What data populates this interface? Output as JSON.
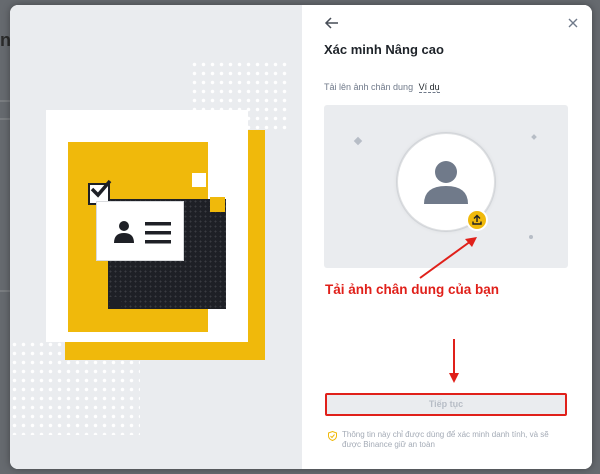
{
  "background": {
    "partial_letter": "n"
  },
  "modal": {
    "title": "Xác minh Nâng cao",
    "upload_label": "Tải lên ảnh chân dung",
    "example_link": "Ví dụ",
    "annotation": "Tải ảnh chân dung của bạn",
    "continue_button": "Tiếp tục",
    "security_note": "Thông tin này chỉ được dùng để xác minh danh tính, và sẽ được Binance giữ an toàn"
  },
  "colors": {
    "accent": "#f0b90b",
    "annotation_red": "#e0201a",
    "dark": "#1e2026",
    "panel_gray": "#eaecef"
  },
  "icons": [
    "back-arrow-icon",
    "close-icon",
    "avatar-icon",
    "upload-icon",
    "shield-check-icon",
    "checkmark-icon",
    "id-card-icon"
  ]
}
